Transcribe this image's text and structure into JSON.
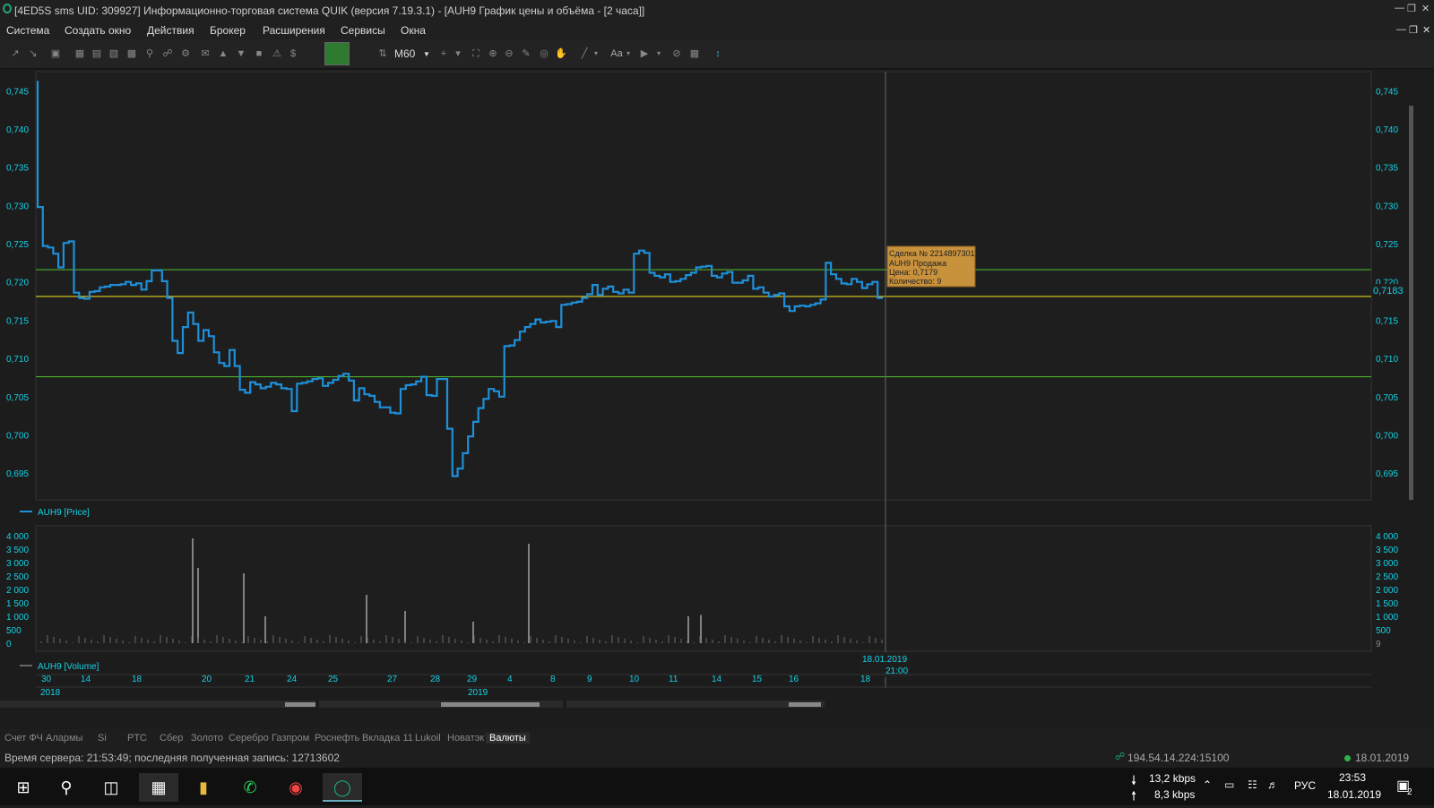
{
  "window": {
    "title": "[4ED5S sms UID: 309927] Информационно-торговая система QUIK (версия 7.19.3.1) - [AUH9 График цены и объёма - [2 часа]]"
  },
  "menu": [
    "Система",
    "Создать окно",
    "Действия",
    "Брокер",
    "Расширения",
    "Сервисы",
    "Окна"
  ],
  "toolbar": {
    "timeframe": "M60",
    "font_label": "Aa"
  },
  "chart": {
    "price_ticks": [
      "0,745",
      "0,740",
      "0,735",
      "0,730",
      "0,725",
      "0,720",
      "0,715",
      "0,710",
      "0,705",
      "0,700",
      "0,695"
    ],
    "current_price": "0,7183",
    "price_legend": "AUH9 [Price]",
    "volume_ticks": [
      "4 000",
      "3 500",
      "3 000",
      "2 500",
      "2 000",
      "1 500",
      "1 000",
      "500",
      "0"
    ],
    "volume_right_last": "9",
    "volume_legend": "AUH9 [Volume]",
    "tooltip": [
      "Сделка № 2214897301",
      "AUH9 Продажа",
      "Цена: 0,7179",
      "Количество: 9"
    ],
    "cursor_date": "18.01.2019",
    "cursor_time": "21:00",
    "date_ticks": [
      "30",
      "14",
      "18",
      "20",
      "21",
      "24",
      "25",
      "27",
      "28",
      "29",
      "4",
      "8",
      "9",
      "10",
      "11",
      "14",
      "15",
      "16",
      "18"
    ],
    "years": [
      "2018",
      "2019"
    ],
    "colors": {
      "price": "#1e8fd8",
      "green_level": "#4caf2a",
      "yellow_level": "#e0d020",
      "tooltip_bg": "#c8913c",
      "axis_text": "#14d2e6"
    }
  },
  "chart_data": {
    "type": "line",
    "title": "AUH9 График цены и объёма - [2 часа]",
    "series": [
      {
        "name": "AUH9 [Price]",
        "values": [
          0.7463,
          0.7298,
          0.7247,
          0.7245,
          0.7237,
          0.7219,
          0.7251,
          0.7253,
          0.7186,
          0.7179,
          0.7178,
          0.7187,
          0.7188,
          0.7193,
          0.7194,
          0.7196,
          0.7196,
          0.7197,
          0.72,
          0.7196,
          0.7198,
          0.719,
          0.7201,
          0.7215,
          0.7215,
          0.7201,
          0.7179,
          0.7123,
          0.7107,
          0.7141,
          0.716,
          0.7145,
          0.7123,
          0.7137,
          0.7129,
          0.7108,
          0.7094,
          0.709,
          0.7111,
          0.709,
          0.7059,
          0.7055,
          0.7069,
          0.7066,
          0.7061,
          0.7063,
          0.7068,
          0.7066,
          0.7061,
          0.706,
          0.7031,
          0.7067,
          0.7068,
          0.707,
          0.7073,
          0.7074,
          0.7064,
          0.7068,
          0.7072,
          0.7077,
          0.708,
          0.7071,
          0.7045,
          0.7061,
          0.7053,
          0.7051,
          0.7043,
          0.7036,
          0.7036,
          0.7029,
          0.7028,
          0.706,
          0.7065,
          0.7066,
          0.707,
          0.7076,
          0.7052,
          0.7051,
          0.7073,
          0.7073,
          0.7008,
          0.6946,
          0.6956,
          0.6976,
          0.6998,
          0.7017,
          0.7035,
          0.7047,
          0.706,
          0.7057,
          0.705,
          0.7116,
          0.7117,
          0.7124,
          0.7135,
          0.7141,
          0.7145,
          0.7151,
          0.7147,
          0.7148,
          0.7149,
          0.7141,
          0.717,
          0.7171,
          0.7173,
          0.7174,
          0.7179,
          0.7184,
          0.7196,
          0.7183,
          0.7191,
          0.7194,
          0.7187,
          0.7185,
          0.719,
          0.7186,
          0.7237,
          0.7241,
          0.7238,
          0.7212,
          0.7208,
          0.7206,
          0.721,
          0.72,
          0.7201,
          0.7204,
          0.7209,
          0.7212,
          0.7219,
          0.722,
          0.7221,
          0.7208,
          0.7206,
          0.7211,
          0.7213,
          0.7199,
          0.7199,
          0.7202,
          0.7208,
          0.7191,
          0.7193,
          0.7186,
          0.7181,
          0.7183,
          0.7185,
          0.7168,
          0.7162,
          0.7168,
          0.7169,
          0.7168,
          0.717,
          0.7172,
          0.7177,
          0.7225,
          0.721,
          0.7204,
          0.7198,
          0.7197,
          0.7204,
          0.72,
          0.7192,
          0.7197,
          0.72,
          0.7179
        ]
      }
    ],
    "volume": {
      "name": "AUH9 [Volume]",
      "spikes": [
        {
          "x": "20",
          "value": 3900
        },
        {
          "x": "20",
          "value": 2800
        },
        {
          "x": "21",
          "value": 2600
        },
        {
          "x": "21",
          "value": 1000
        },
        {
          "x": "25",
          "value": 1800
        },
        {
          "x": "27",
          "value": 1200
        },
        {
          "x": "29",
          "value": 800
        },
        {
          "x": "4",
          "value": 3700
        },
        {
          "x": "11",
          "value": 1000
        },
        {
          "x": "11",
          "value": 1050
        }
      ]
    },
    "levels": [
      {
        "value": 0.7216,
        "color": "green"
      },
      {
        "value": 0.7076,
        "color": "green"
      },
      {
        "value": 0.7181,
        "color": "yellow"
      }
    ],
    "ylim": [
      0.6915,
      0.7475
    ],
    "volume_ylim": [
      0,
      4000
    ]
  },
  "tabs": [
    "Счет ФЧ",
    "Алармы",
    "Si",
    "PTC",
    "Сбер",
    "Золото",
    "Серебро",
    "Газпром",
    "Роснефть",
    "Вкладка 11",
    "Lukoil",
    "Новатэк",
    "Валюты"
  ],
  "status": {
    "left": "Время сервера: 21:53:49; последняя полученная запись: 12713602",
    "ip": "194.54.14.224:15100",
    "date": "18.01.2019"
  },
  "taskbar": {
    "down_speed": "13,2 kbps",
    "up_speed": "8,3 kbps",
    "lang": "РУС",
    "time": "23:53",
    "date": "18.01.2019",
    "notif_count": "2"
  }
}
